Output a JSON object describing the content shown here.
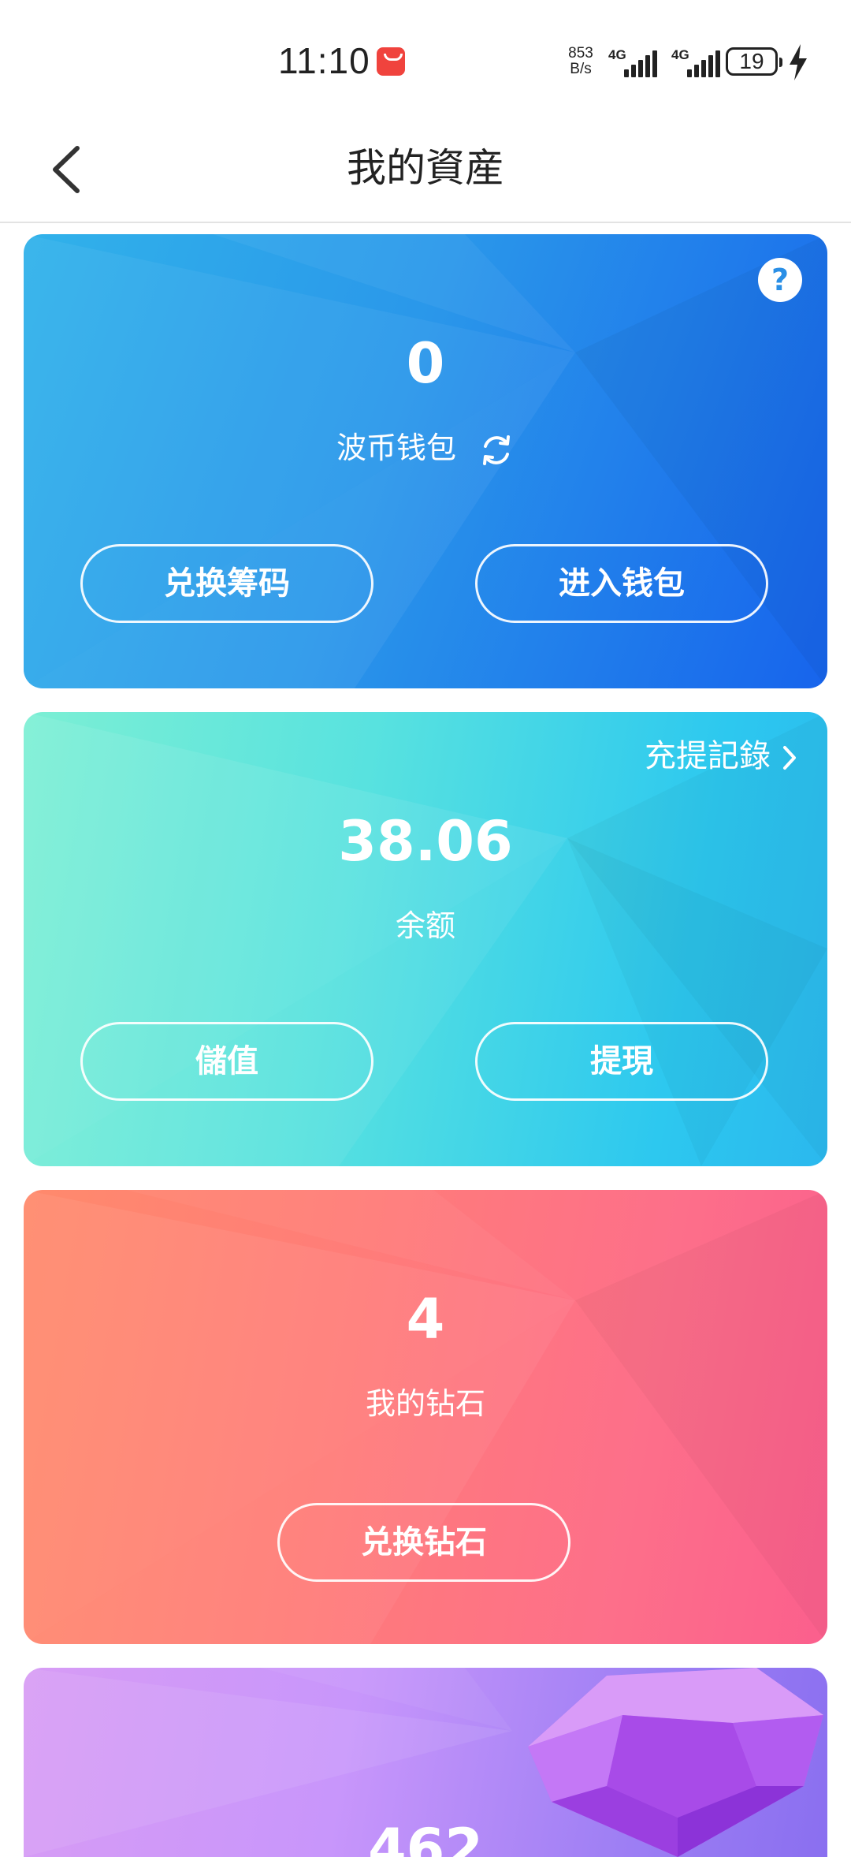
{
  "status_bar": {
    "time": "11:10",
    "net_rate_value": "853",
    "net_rate_unit": "B/s",
    "sim1_tag": "4G",
    "sim2_tag": "4G",
    "battery": "19"
  },
  "header": {
    "title": "我的資産"
  },
  "wallet_card": {
    "value": "0",
    "label": "波币钱包",
    "btn_left": "兑换筹码",
    "btn_right": "进入钱包"
  },
  "balance_card": {
    "record_link": "充提記錄",
    "value": "38.06",
    "label": "余额",
    "btn_left": "儲值",
    "btn_right": "提現"
  },
  "diamond_card": {
    "value": "4",
    "label": "我的钻石",
    "btn": "兑换钻石"
  },
  "gem_card": {
    "value": "462"
  }
}
